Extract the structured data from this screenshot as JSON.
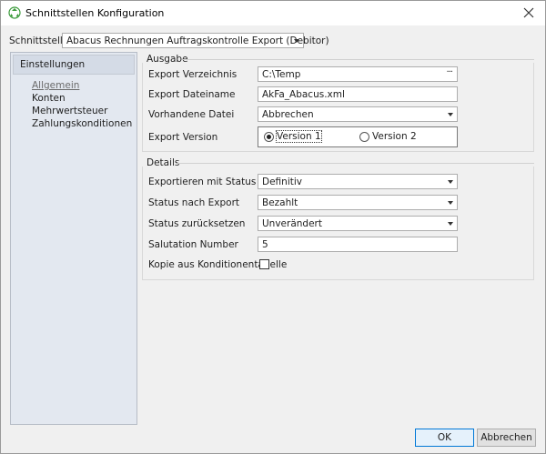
{
  "window": {
    "title": "Schnittstellen Konfiguration"
  },
  "header": {
    "interface_label": "Schnittstelle",
    "interface_value": "Abacus Rechnungen Auftragskontrolle Export (Debitor)"
  },
  "nav": {
    "header": "Einstellungen",
    "items": [
      {
        "label": "Allgemein",
        "active": true
      },
      {
        "label": "Konten"
      },
      {
        "label": "Mehrwertsteuer"
      },
      {
        "label": "Zahlungskonditionen"
      }
    ]
  },
  "ausgabe": {
    "title": "Ausgabe",
    "export_dir_label": "Export Verzeichnis",
    "export_dir_value": "C:\\Temp",
    "browse_label": "···",
    "export_filename_label": "Export Dateiname",
    "export_filename_value": "AkFa_Abacus.xml",
    "existing_file_label": "Vorhandene Datei",
    "existing_file_value": "Abbrechen",
    "export_version_label": "Export Version",
    "version1_label": "Version 1",
    "version2_label": "Version 2",
    "selected_version": "Version 1"
  },
  "details": {
    "title": "Details",
    "export_status_label": "Exportieren mit Status",
    "export_status_value": "Definitiv",
    "status_after_label": "Status nach Export",
    "status_after_value": "Bezahlt",
    "status_reset_label": "Status zurücksetzen",
    "status_reset_value": "Unverändert",
    "salutation_label": "Salutation Number",
    "salutation_value": "5",
    "copy_conditions_label": "Kopie aus Konditionentabelle",
    "copy_conditions_checked": false
  },
  "footer": {
    "ok_label": "OK",
    "cancel_label": "Abbrechen"
  },
  "colors": {
    "accent": "#0078d7",
    "nav_background": "#e3e8f0"
  }
}
